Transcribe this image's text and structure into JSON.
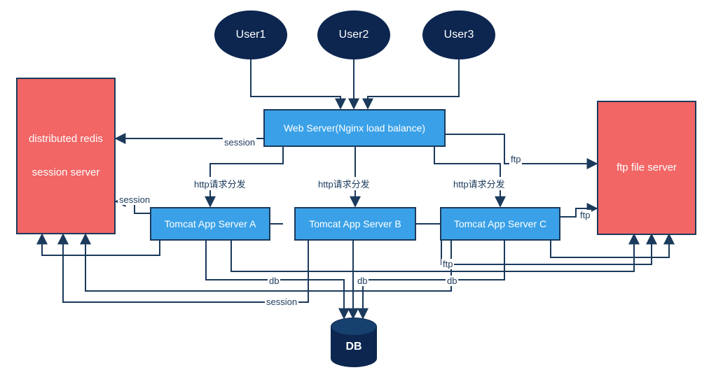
{
  "users": [
    "User1",
    "User2",
    "User3"
  ],
  "redis": "distributed redis\n\nsession server",
  "webserver": "Web Server(Nginx load balance)",
  "tomcats": [
    "Tomcat App Server A",
    "Tomcat App Server B",
    "Tomcat App Server C"
  ],
  "ftp": "ftp file server",
  "db": "DB",
  "labels": {
    "session": "session",
    "http": "http请求分发",
    "ftp": "ftp",
    "db": "db"
  },
  "colors": {
    "navy": "#0c2650",
    "blue": "#3aa1e8",
    "red": "#f26666",
    "line": "#1b3a5c"
  },
  "chart_data": {
    "type": "diagram",
    "nodes": [
      {
        "id": "user1",
        "label": "User1",
        "kind": "user"
      },
      {
        "id": "user2",
        "label": "User2",
        "kind": "user"
      },
      {
        "id": "user3",
        "label": "User3",
        "kind": "user"
      },
      {
        "id": "redis",
        "label": "distributed redis session server",
        "kind": "redis-server"
      },
      {
        "id": "nginx",
        "label": "Web Server(Nginx load balance)",
        "kind": "web-server"
      },
      {
        "id": "tA",
        "label": "Tomcat App Server A",
        "kind": "app-server"
      },
      {
        "id": "tB",
        "label": "Tomcat App Server B",
        "kind": "app-server"
      },
      {
        "id": "tC",
        "label": "Tomcat App Server C",
        "kind": "app-server"
      },
      {
        "id": "ftp",
        "label": "ftp file server",
        "kind": "ftp-server"
      },
      {
        "id": "db",
        "label": "DB",
        "kind": "database"
      }
    ],
    "edges": [
      {
        "from": "user1",
        "to": "nginx"
      },
      {
        "from": "user2",
        "to": "nginx"
      },
      {
        "from": "user3",
        "to": "nginx"
      },
      {
        "from": "nginx",
        "to": "redis",
        "label": "session"
      },
      {
        "from": "nginx",
        "to": "ftp",
        "label": "ftp"
      },
      {
        "from": "nginx",
        "to": "tA",
        "label": "http请求分发"
      },
      {
        "from": "nginx",
        "to": "tB",
        "label": "http请求分发"
      },
      {
        "from": "nginx",
        "to": "tC",
        "label": "http请求分发"
      },
      {
        "from": "tA",
        "to": "redis",
        "label": "session"
      },
      {
        "from": "tB",
        "to": "redis",
        "label": "session"
      },
      {
        "from": "tC",
        "to": "redis",
        "label": "session"
      },
      {
        "from": "tA",
        "to": "ftp",
        "label": "ftp"
      },
      {
        "from": "tB",
        "to": "ftp",
        "label": "ftp"
      },
      {
        "from": "tC",
        "to": "ftp",
        "label": "ftp"
      },
      {
        "from": "tA",
        "to": "db",
        "label": "db"
      },
      {
        "from": "tB",
        "to": "db",
        "label": "db"
      },
      {
        "from": "tC",
        "to": "db",
        "label": "db"
      }
    ]
  }
}
